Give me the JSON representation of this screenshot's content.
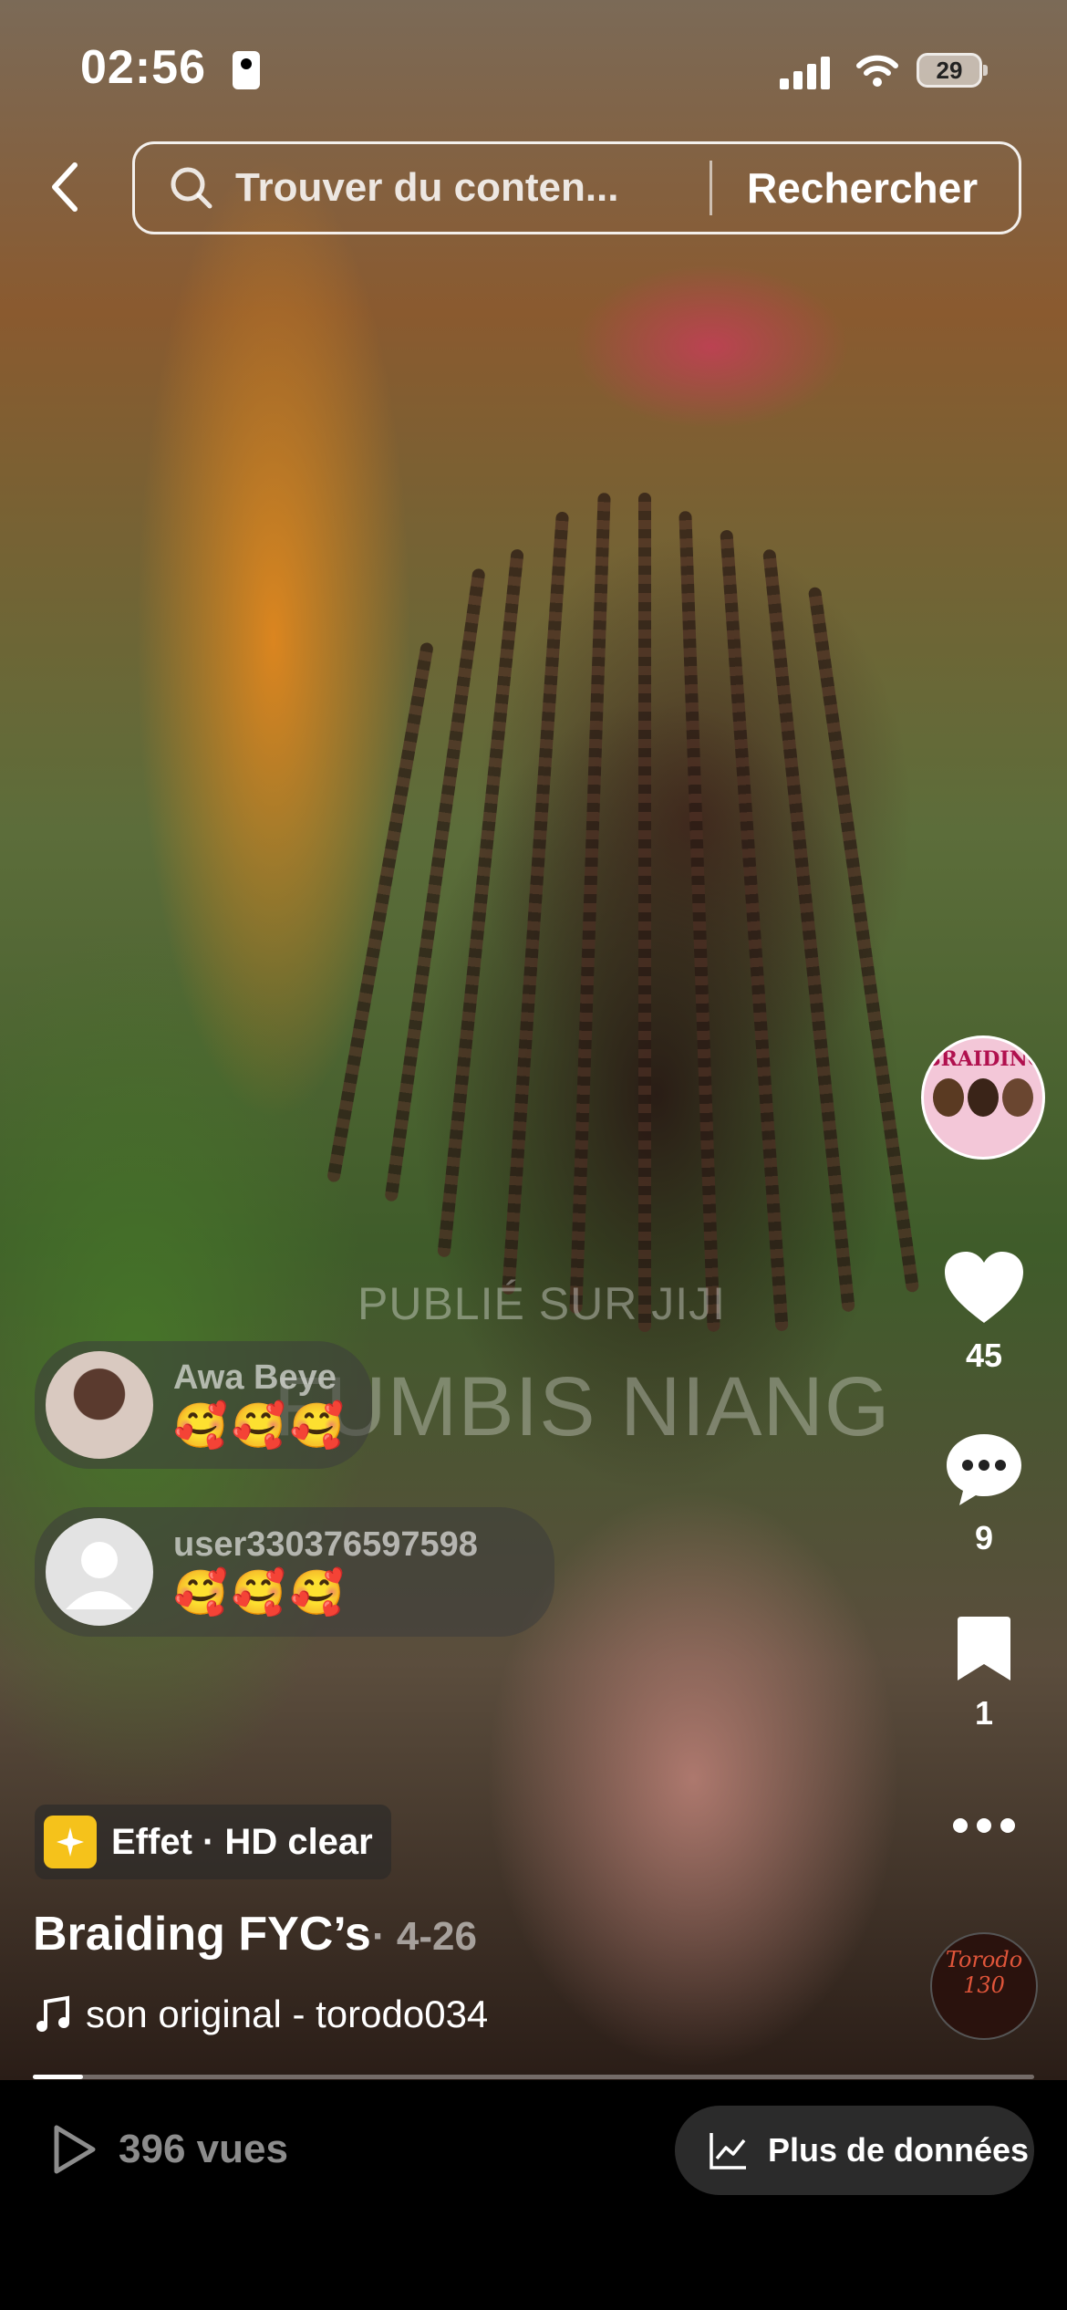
{
  "status_bar": {
    "time": "02:56",
    "battery_level": "29"
  },
  "search": {
    "placeholder": "Trouver du conten...",
    "button_label": "Rechercher"
  },
  "watermark": {
    "line1": "PUBLIÉ SUR JIJI",
    "line2": "FUMBIS NIANG"
  },
  "comments": [
    {
      "user": "Awa Beye",
      "text": "🥰🥰🥰"
    },
    {
      "user": "user330376597598",
      "text": "🥰🥰🥰"
    }
  ],
  "side_actions": {
    "profile_label": "BRAIDING",
    "likes": "45",
    "comments": "9",
    "saves": "1"
  },
  "effect": {
    "label": "Effet · HD clear"
  },
  "caption": {
    "title": "Braiding FYC’s",
    "date": "· 4-26"
  },
  "music": {
    "label": "son original - torodo034"
  },
  "sound_disc": {
    "label": "Torodo 130"
  },
  "progress": {
    "fraction": 0.05
  },
  "bottom_bar": {
    "views": "396 vues",
    "more_data_label": "Plus de données"
  },
  "colors": {
    "effect_icon": "#f5c21b",
    "pill_background": "#2b2b2b"
  }
}
